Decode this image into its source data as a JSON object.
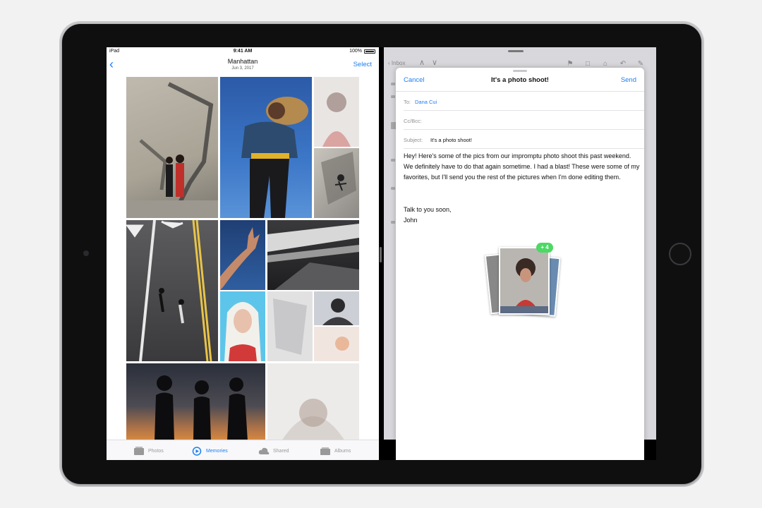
{
  "status_bar": {
    "device": "iPad",
    "time": "9:41 AM",
    "battery": "100%"
  },
  "photos": {
    "nav": {
      "title": "Manhattan",
      "subtitle": "Jun 3, 2017",
      "select_label": "Select"
    },
    "tabs": [
      {
        "label": "Photos",
        "icon": "photos-icon",
        "active": false
      },
      {
        "label": "Memories",
        "icon": "memories-icon",
        "active": true
      },
      {
        "label": "Shared",
        "icon": "cloud-icon",
        "active": false
      },
      {
        "label": "Albums",
        "icon": "albums-icon",
        "active": false
      }
    ]
  },
  "mail": {
    "toolbar": {
      "back_label": "Inbox"
    },
    "compose": {
      "cancel_label": "Cancel",
      "title": "It's a photo shoot!",
      "send_label": "Send",
      "to_label": "To:",
      "to_value": "Dana Cui",
      "cc_label": "Cc/Bcc:",
      "subject_label": "Subject:",
      "subject_value": "It's a photo shoot!",
      "body": "Hey! Here's some of the pics from our impromptu photo shoot this past weekend. We definitely have to do that again sometime. I had a blast! These were some of my favorites, but I'll send you the rest of the pictures when I'm done editing them.",
      "signoff_line1": "Talk to you soon,",
      "signoff_line2": "John",
      "attachment_badge": "+ 4"
    }
  },
  "colors": {
    "accent": "#1e7ef0",
    "badge": "#4cd964"
  }
}
